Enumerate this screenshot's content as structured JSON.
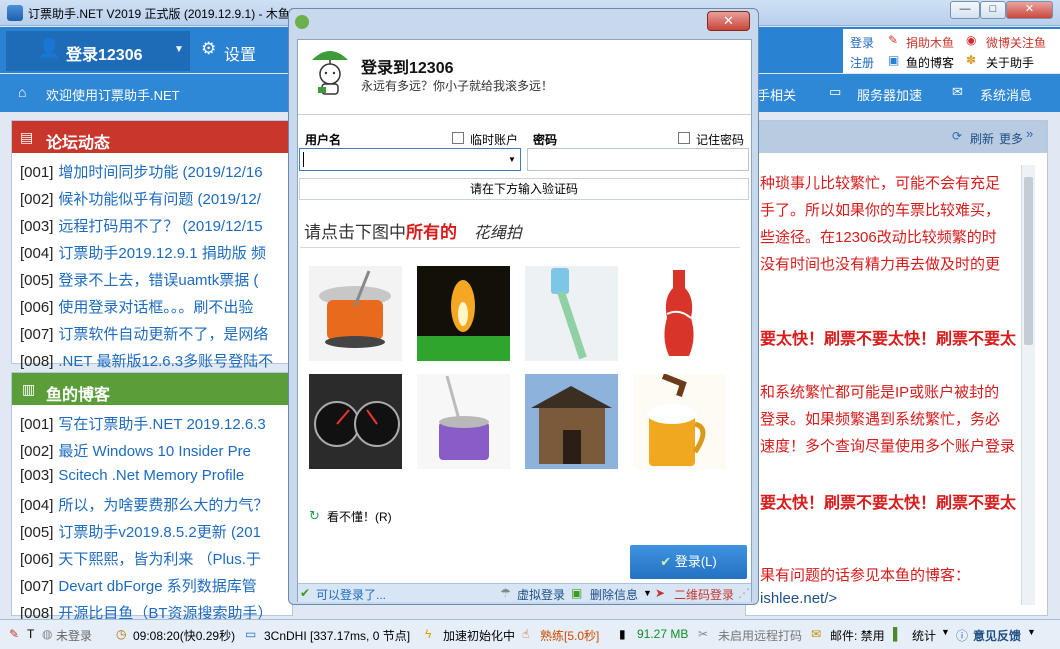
{
  "window": {
    "title": "订票助手.NET V2019 正式版 (2019.12.9.1) - 木鱼订票助手 - 正在检测 - 正在登录",
    "controls": [
      "—",
      "□",
      "✕"
    ]
  },
  "menubar": {
    "login_label": "登录12306",
    "settings_label": "设置",
    "right_links": {
      "login": "登录",
      "register": "注册",
      "donate": "捐助木鱼",
      "weibo": "微博关注鱼",
      "blog": "鱼的博客",
      "about": "关于助手"
    }
  },
  "navbar": {
    "welcome": "欢迎使用订票助手.NET",
    "items": [
      "手相关",
      "服务器加速",
      "系统消息"
    ]
  },
  "forum": {
    "title": "论坛动态",
    "items": [
      {
        "no": "[001]",
        "text": "增加时间同步功能 (2019/12/16"
      },
      {
        "no": "[002]",
        "text": "候补功能似乎有问题 (2019/12/"
      },
      {
        "no": "[003]",
        "text": "远程打码用不了？ (2019/12/15"
      },
      {
        "no": "[004]",
        "text": "订票助手2019.12.9.1 捐助版 频"
      },
      {
        "no": "[005]",
        "text": "登录不上去，错误uamtk票据 ("
      },
      {
        "no": "[006]",
        "text": "使用登录对话框。。。刷不出验"
      },
      {
        "no": "[007]",
        "text": "订票软件自动更新不了，是网络"
      },
      {
        "no": "[008]",
        "text": ".NET 最新版12.6.3多账号登陆不"
      }
    ]
  },
  "blog": {
    "title": "鱼的博客",
    "items": [
      {
        "no": "[001]",
        "text": "写在订票助手.NET 2019.12.6.3"
      },
      {
        "no": "[002]",
        "text": "最近 Windows 10 Insider Pre"
      },
      {
        "no": "[003]",
        "text": "Scitech .Net Memory Profile"
      },
      {
        "no": "[004]",
        "text": "所以，为啥要费那么大的力气？"
      },
      {
        "no": "[005]",
        "text": "订票助手v2019.8.5.2更新 (201"
      },
      {
        "no": "[006]",
        "text": "天下熙熙，皆为利来 （Plus.于"
      },
      {
        "no": "[007]",
        "text": "Devart dbForge 系列数据库管"
      },
      {
        "no": "[008]",
        "text": "开源比目鱼（BT资源搜索助手）"
      }
    ]
  },
  "right_panel": {
    "refresh": "刷新",
    "more": "更多",
    "lines": [
      "种琐事儿比较繁忙，可能不会有充足",
      "手了。所以如果你的车票比较难买，",
      "些途径。在12306改动比较频繁的时",
      "没有时间也没有精力再去做及时的更",
      "要太快！刷票不要太快！刷票不要太",
      "和系统繁忙都可能是IP或账户被封的",
      "登录。如果频繁遇到系统繁忙，务必",
      "速度！多个查询尽量使用多个账户登录",
      "要太快！刷票不要太快！刷票不要太",
      "果有问题的话参见本鱼的博客：",
      "ishlee.net/>"
    ]
  },
  "dialog": {
    "title": "登录到12306",
    "subtitle": "永远有多远？你小子就给我滚多远！",
    "close": "✕",
    "username_label": "用户名",
    "temp_account_label": "临时账户",
    "password_label": "密码",
    "remember_label": "记住密码",
    "username_value": "",
    "password_value": "",
    "captcha_hint": "请在下方输入验证码",
    "captcha_prompt": "请点击下图中",
    "captcha_prompt_red": "所有的",
    "captcha_target": "花绳拍",
    "captcha_images": [
      "mop-bucket-orange",
      "candle-flame",
      "toothbrush",
      "cola-bottle",
      "speedometer",
      "mop-bucket-purple",
      "temple-gate",
      "beer-mug"
    ],
    "refresh_link": "看不懂！(R)",
    "login_button": "登录(L)",
    "footer": {
      "can_login": "可以登录了...",
      "virtual_login": "虚拟登录",
      "delete_info": "删除信息",
      "qr_login": "二维码登录"
    }
  },
  "statusbar": {
    "t": "T",
    "not_logged": "未登录",
    "time": "09:08:20(快0.29秒)",
    "server": "3CnDHI [337.17ms, 0 节点]",
    "accel": "加速初始化中",
    "skill": "熟练[5.0秒]",
    "memory": "91.27 MB",
    "remote": "未启用远程打码",
    "mail": "邮件: 禁用",
    "stats": "统计",
    "feedback": "意见反馈"
  },
  "colors": {
    "accent_blue": "#2a82d2",
    "forum_red": "#c9362c",
    "blog_green": "#5b9e39",
    "notice_red": "#d81b1b"
  }
}
